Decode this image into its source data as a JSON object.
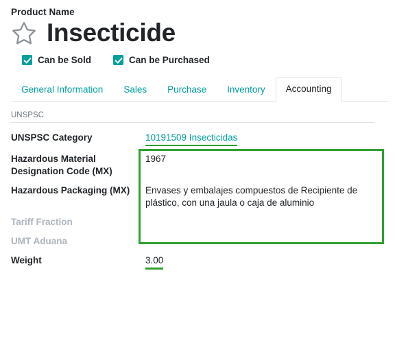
{
  "header": {
    "product_name_label": "Product Name",
    "title": "Insecticide",
    "star_icon": "star-outline-icon"
  },
  "checkboxes": [
    {
      "label": "Can be Sold",
      "checked": true
    },
    {
      "label": "Can be Purchased",
      "checked": true
    }
  ],
  "tabs": [
    {
      "label": "General Information",
      "active": false
    },
    {
      "label": "Sales",
      "active": false
    },
    {
      "label": "Purchase",
      "active": false
    },
    {
      "label": "Inventory",
      "active": false
    },
    {
      "label": "Accounting",
      "active": true
    }
  ],
  "section": {
    "title": "UNSPSC"
  },
  "fields": [
    {
      "label": "UNSPSC Category",
      "value": "10191509 Insecticidas",
      "style": "link"
    },
    {
      "label": "Hazardous Material Designation Code (MX)",
      "value": "1967",
      "style": "text"
    },
    {
      "label": "Hazardous Packaging (MX)",
      "value": "Envases y embalajes compuestos de Recipiente de plástico, con una jaula o caja de aluminio",
      "style": "text"
    },
    {
      "label": "Tariff Fraction",
      "value": "",
      "style": "muted"
    },
    {
      "label": "UMT Aduana",
      "value": "",
      "style": "muted"
    },
    {
      "label": "Weight",
      "value": "3.00",
      "style": "underlined"
    }
  ],
  "colors": {
    "accent": "#00A09D",
    "highlight": "#2EA02E",
    "text": "#212529",
    "muted": "#adb5bd"
  }
}
